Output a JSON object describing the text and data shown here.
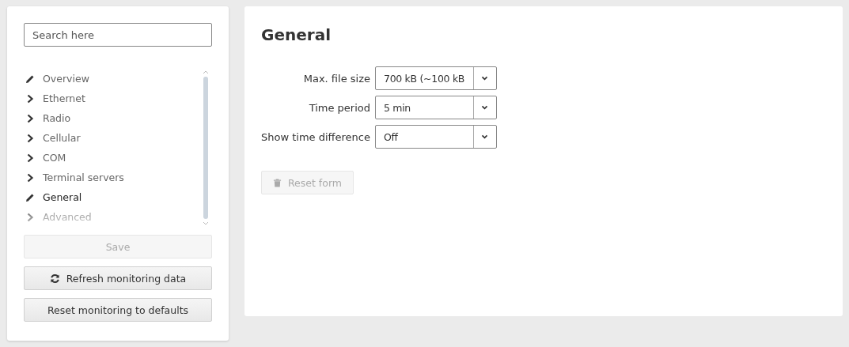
{
  "sidebar": {
    "search": {
      "placeholder": "Search here"
    },
    "items": [
      {
        "label": "Overview",
        "kind": "edit",
        "selected": false
      },
      {
        "label": "Ethernet",
        "kind": "expand",
        "selected": false
      },
      {
        "label": "Radio",
        "kind": "expand",
        "selected": false
      },
      {
        "label": "Cellular",
        "kind": "expand",
        "selected": false
      },
      {
        "label": "COM",
        "kind": "expand",
        "selected": false
      },
      {
        "label": "Terminal servers",
        "kind": "expand",
        "selected": false
      },
      {
        "label": "General",
        "kind": "edit",
        "selected": true
      },
      {
        "label": "Advanced",
        "kind": "expand",
        "selected": false
      }
    ],
    "buttons": [
      {
        "label": "Save",
        "kind": "plain",
        "disabled": true
      },
      {
        "label": "Refresh monitoring data",
        "kind": "refresh",
        "disabled": false
      },
      {
        "label": "Reset monitoring to defaults",
        "kind": "plain",
        "disabled": false
      }
    ]
  },
  "main": {
    "title": "General",
    "fields": [
      {
        "label": "Max. file size",
        "value": "700 kB (~100 kB"
      },
      {
        "label": "Time period",
        "value": "5 min"
      },
      {
        "label": "Show time difference",
        "value": "Off"
      }
    ],
    "reset_button": {
      "label": "Reset form",
      "disabled": true
    }
  }
}
